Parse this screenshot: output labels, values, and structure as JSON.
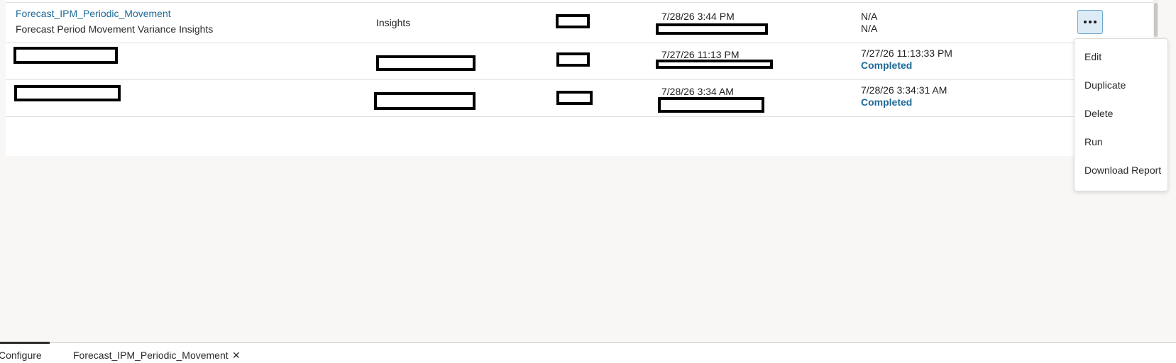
{
  "rows": [
    {
      "name": "Forecast_IPM_Periodic_Movement",
      "description": "Forecast Period Movement Variance Insights",
      "type": "Insights",
      "last_run": "7/28/26 3:44 PM",
      "status_time": "N/A",
      "status": "N/A"
    },
    {
      "last_run": "7/27/26 11:13 PM",
      "status_time": "7/27/26 11:13:33 PM",
      "status": "Completed"
    },
    {
      "last_run": "7/28/26 3:34 AM",
      "status_time": "7/28/26 3:34:31 AM",
      "status": "Completed"
    }
  ],
  "actions_menu": {
    "items": [
      "Edit",
      "Duplicate",
      "Delete",
      "Run",
      "Download Report"
    ]
  },
  "tabs": [
    {
      "label": "Configure"
    },
    {
      "label": "Forecast_IPM_Periodic_Movement"
    }
  ],
  "colors": {
    "link": "#1f6a97",
    "status": "#1f6a97",
    "background": "#f8f7f5",
    "button_active": "#dcebf5"
  },
  "icons": {
    "more": "more-horizontal-icon",
    "close": "close-icon"
  }
}
